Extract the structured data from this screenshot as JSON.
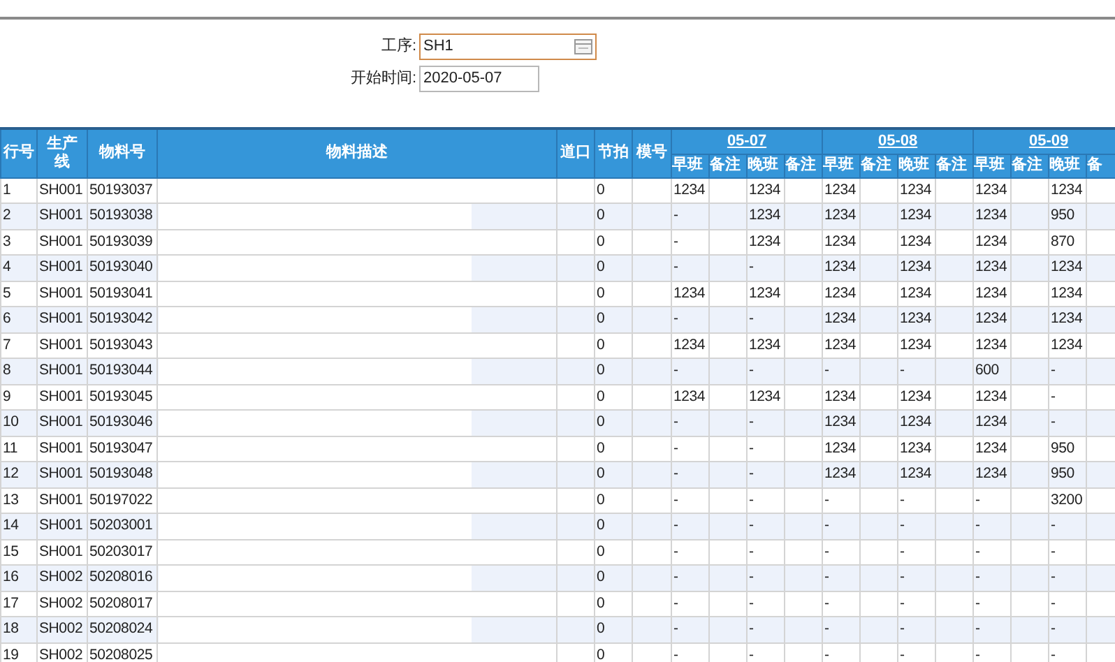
{
  "form": {
    "fields": [
      {
        "label": "工序:",
        "value": "SH1",
        "kind": "picker",
        "focused": true
      },
      {
        "label": "开始时间:",
        "value": "2020-05-07",
        "kind": "date",
        "focused": false
      }
    ]
  },
  "table": {
    "columns": [
      "行号",
      "生产线",
      "物料号",
      "物料描述",
      "道口",
      "节拍",
      "模号"
    ],
    "dates": [
      {
        "date": "05-07",
        "sub": [
          "早班",
          "备注",
          "晚班",
          "备注"
        ]
      },
      {
        "date": "05-08",
        "sub": [
          "早班",
          "备注",
          "晚班",
          "备注"
        ]
      },
      {
        "date": "05-09",
        "sub": [
          "早班",
          "备注",
          "晚班",
          "备"
        ]
      }
    ],
    "rows": [
      {
        "row": "1",
        "line": "SH001",
        "material": "50193037",
        "takt": "0",
        "values": [
          "1234",
          "1234",
          "1234",
          "1234",
          "1234",
          "1234"
        ]
      },
      {
        "row": "2",
        "line": "SH001",
        "material": "50193038",
        "takt": "0",
        "values": [
          "-",
          "1234",
          "1234",
          "1234",
          "1234",
          "950"
        ]
      },
      {
        "row": "3",
        "line": "SH001",
        "material": "50193039",
        "takt": "0",
        "values": [
          "-",
          "1234",
          "1234",
          "1234",
          "1234",
          "870"
        ]
      },
      {
        "row": "4",
        "line": "SH001",
        "material": "50193040",
        "takt": "0",
        "values": [
          "-",
          "-",
          "1234",
          "1234",
          "1234",
          "1234"
        ]
      },
      {
        "row": "5",
        "line": "SH001",
        "material": "50193041",
        "takt": "0",
        "values": [
          "1234",
          "1234",
          "1234",
          "1234",
          "1234",
          "1234"
        ]
      },
      {
        "row": "6",
        "line": "SH001",
        "material": "50193042",
        "takt": "0",
        "values": [
          "-",
          "-",
          "1234",
          "1234",
          "1234",
          "1234"
        ]
      },
      {
        "row": "7",
        "line": "SH001",
        "material": "50193043",
        "takt": "0",
        "values": [
          "1234",
          "1234",
          "1234",
          "1234",
          "1234",
          "1234"
        ]
      },
      {
        "row": "8",
        "line": "SH001",
        "material": "50193044",
        "takt": "0",
        "values": [
          "-",
          "-",
          "-",
          "-",
          "600",
          "-"
        ]
      },
      {
        "row": "9",
        "line": "SH001",
        "material": "50193045",
        "takt": "0",
        "values": [
          "1234",
          "1234",
          "1234",
          "1234",
          "1234",
          "-"
        ]
      },
      {
        "row": "10",
        "line": "SH001",
        "material": "50193046",
        "takt": "0",
        "values": [
          "-",
          "-",
          "1234",
          "1234",
          "1234",
          "-"
        ]
      },
      {
        "row": "11",
        "line": "SH001",
        "material": "50193047",
        "takt": "0",
        "values": [
          "-",
          "-",
          "1234",
          "1234",
          "1234",
          "950"
        ]
      },
      {
        "row": "12",
        "line": "SH001",
        "material": "50193048",
        "takt": "0",
        "values": [
          "-",
          "-",
          "1234",
          "1234",
          "1234",
          "950"
        ]
      },
      {
        "row": "13",
        "line": "SH001",
        "material": "50197022",
        "takt": "0",
        "values": [
          "-",
          "-",
          "-",
          "-",
          "-",
          "3200"
        ]
      },
      {
        "row": "14",
        "line": "SH001",
        "material": "50203001",
        "takt": "0",
        "values": [
          "-",
          "-",
          "-",
          "-",
          "-",
          "-"
        ]
      },
      {
        "row": "15",
        "line": "SH001",
        "material": "50203017",
        "takt": "0",
        "values": [
          "-",
          "-",
          "-",
          "-",
          "-",
          "-"
        ]
      },
      {
        "row": "16",
        "line": "SH002",
        "material": "50208016",
        "takt": "0",
        "values": [
          "-",
          "-",
          "-",
          "-",
          "-",
          "-"
        ]
      },
      {
        "row": "17",
        "line": "SH002",
        "material": "50208017",
        "takt": "0",
        "values": [
          "-",
          "-",
          "-",
          "-",
          "-",
          "-"
        ]
      },
      {
        "row": "18",
        "line": "SH002",
        "material": "50208024",
        "takt": "0",
        "values": [
          "-",
          "-",
          "-",
          "-",
          "-",
          "-"
        ]
      },
      {
        "row": "19",
        "line": "SH002",
        "material": "50208025",
        "takt": "0",
        "values": [
          "-",
          "-",
          "-",
          "-",
          "-",
          "-"
        ]
      }
    ]
  }
}
